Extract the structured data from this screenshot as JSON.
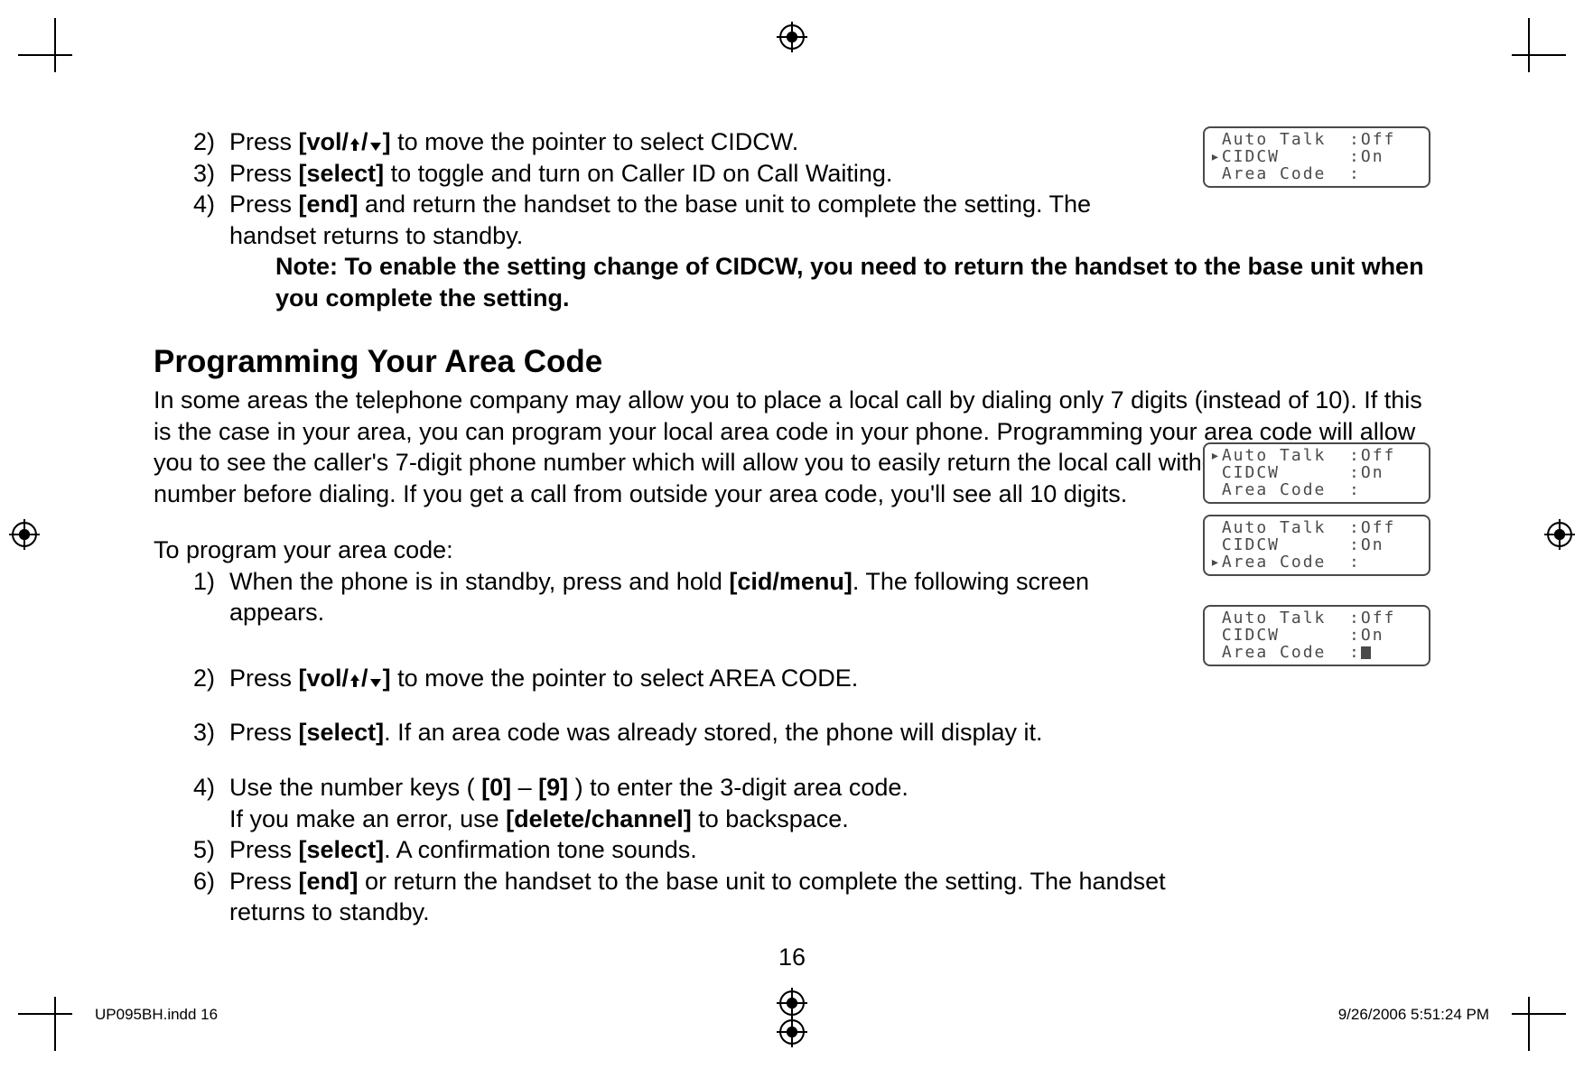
{
  "steps_cidcw": [
    {
      "n": "2)",
      "pre": "Press ",
      "key": "[vol/",
      "post": "]",
      "tail": " to move the pointer to select CIDCW."
    },
    {
      "n": "3)",
      "pre": "Press ",
      "key": "[select]",
      "tail": " to toggle and turn on Caller ID on Call Waiting."
    },
    {
      "n": "4)",
      "pre": "Press ",
      "key": "[end]",
      "tail": " and return the handset to the base unit to complete the setting. The handset returns to standby."
    }
  ],
  "note": "Note: To enable the setting change of CIDCW, you need to return the handset to the base unit when you complete the setting.",
  "heading": "Programming Your Area Code",
  "para1": "In some areas the telephone company may allow you to place a local call by dialing only 7 digits (instead of 10). If this is the case in your area, you can program your local area code in your phone. Programming your area code will allow you to see the caller's 7-digit phone number which will allow you to easily return the local call without modifying the number before dialing. If you get a call from outside your area code, you'll see all 10 digits.",
  "lead": "To program your area code:",
  "steps_area": {
    "s1": {
      "n": "1)",
      "pre": "When the phone is in standby, press and hold ",
      "key": "[cid/menu]",
      "tail": ". The following screen appears."
    },
    "s2": {
      "n": "2)",
      "pre": "Press ",
      "key": "[vol/",
      "post": "]",
      "tail": " to move the pointer to select AREA CODE."
    },
    "s3": {
      "n": "3)",
      "pre": "Press ",
      "key": "[select]",
      "tail": ". If an area code was already stored, the phone will display it."
    },
    "s4": {
      "n": "4)",
      "pre": "Use the number keys ( ",
      "key1": "[0]",
      "mid": " – ",
      "key2": "[9]",
      "tail1": " ) to enter the 3-digit area code.",
      "tail2a": "If you make an error, use ",
      "tail2key": "[delete/channel]",
      "tail2b": " to backspace."
    },
    "s5": {
      "n": "5)",
      "pre": "Press ",
      "key": "[select]",
      "tail": ". A confirmation tone sounds."
    },
    "s6": {
      "n": "6)",
      "pre": "Press ",
      "key": "[end]",
      "tail": " or return the handset to the base unit to complete the setting. The handset returns to standby."
    }
  },
  "lcd1": {
    "l1": " Auto Talk  :Off",
    "l2": "▸CIDCW      :On",
    "l3": " Area Code  :"
  },
  "lcd2": {
    "l1": "▸Auto Talk  :Off",
    "l2": " CIDCW      :On",
    "l3": " Area Code  :"
  },
  "lcd3": {
    "l1": " Auto Talk  :Off",
    "l2": " CIDCW      :On",
    "l3": "▸Area Code  :"
  },
  "lcd4": {
    "l1": " Auto Talk  :Off",
    "l2": " CIDCW      :On",
    "l3": " Area Code  :"
  },
  "page_number": "16",
  "footer_left": "UP095BH.indd   16",
  "footer_right": "9/26/2006   5:51:24 PM"
}
